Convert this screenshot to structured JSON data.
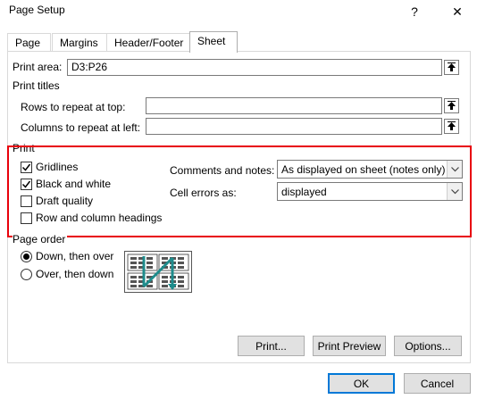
{
  "window": {
    "title": "Page Setup",
    "help_label": "?",
    "close_label": "✕"
  },
  "tabs": [
    {
      "label": "Page"
    },
    {
      "label": "Margins"
    },
    {
      "label": "Header/Footer"
    },
    {
      "label": "Sheet",
      "active": true
    }
  ],
  "print_area": {
    "label": "Print area:",
    "value": "D3:P26"
  },
  "print_titles": {
    "section_label": "Print titles",
    "rows_label": "Rows to repeat at top:",
    "rows_value": "",
    "columns_label": "Columns to repeat at left:",
    "columns_value": ""
  },
  "print": {
    "section_label": "Print",
    "gridlines": {
      "label": "Gridlines",
      "checked": true
    },
    "black_and_white": {
      "label": "Black and white",
      "checked": true
    },
    "draft_quality": {
      "label": "Draft quality",
      "checked": false
    },
    "row_col_headings": {
      "label": "Row and column headings",
      "checked": false
    },
    "comments_label": "Comments and notes:",
    "comments_value": "As displayed on sheet (notes only)",
    "errors_label": "Cell errors as:",
    "errors_value": "displayed"
  },
  "page_order": {
    "section_label": "Page order",
    "down_then_over": {
      "label": "Down, then over",
      "selected": true
    },
    "over_then_down": {
      "label": "Over, then down",
      "selected": false
    }
  },
  "buttons": {
    "print": "Print...",
    "print_preview": "Print Preview",
    "options": "Options...",
    "ok": "OK",
    "cancel": "Cancel"
  },
  "colors": {
    "highlight_box": "#e8000b",
    "accent": "#0078d7",
    "page_order_arrow": "#1e8c8c"
  }
}
